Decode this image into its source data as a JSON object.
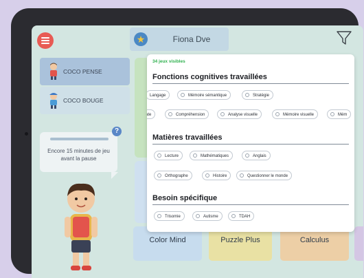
{
  "header": {
    "profile_name": "Fiona Dve"
  },
  "sidebar": {
    "items": [
      {
        "label": "COCO PENSE"
      },
      {
        "label": "COCO BOUGE"
      }
    ],
    "pause_message": "Encore 15 minutes de jeu avant la pause",
    "help": "?"
  },
  "games": [
    {
      "label": "Color Mind"
    },
    {
      "label": "Puzzle Plus"
    },
    {
      "label": "Calculus"
    }
  ],
  "filters": {
    "count_text": "34 jeux visibles",
    "sections": [
      {
        "title": "Fonctions cognitives travaillées",
        "rows": [
          [
            "Langage",
            "Mémoire sémantique",
            "Stratégie"
          ],
          [
            "ate",
            "Compréhension",
            "Analyse visuelle",
            "Mémoire visuelle",
            "Mém"
          ]
        ]
      },
      {
        "title": "Matières travaillées",
        "rows": [
          [
            "Lecture",
            "Mathématiques",
            "Anglais"
          ],
          [
            "Orthographe",
            "Histoire",
            "Questionner le monde"
          ]
        ]
      },
      {
        "title": "Besoin spécifique",
        "rows": [
          [
            "Trisomie",
            "Autisme",
            "TDAH"
          ]
        ]
      }
    ]
  },
  "colors": {
    "accent_red": "#e85b54",
    "count_green": "#2fb14e",
    "screen_bg": "#d3e6e1"
  }
}
